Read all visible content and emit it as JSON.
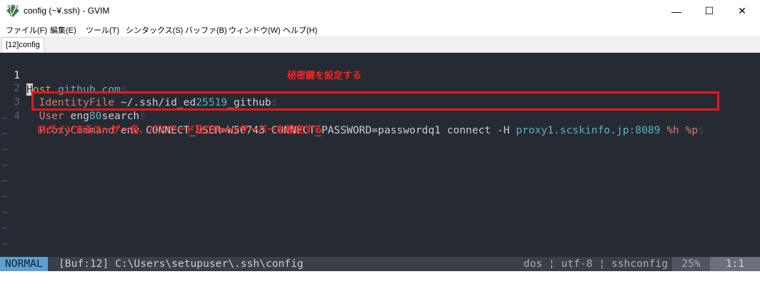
{
  "window": {
    "title": "config (~¥.ssh) - GVIM",
    "controls": {
      "minimize": "—",
      "maximize": "☐",
      "close": "✕"
    }
  },
  "menu": [
    "ファイル(F)",
    "編集(E)",
    "ツール(T)",
    "シンタックス(S)",
    "バッファ(B)",
    "ウィンドウ(W)",
    "ヘルプ(H)"
  ],
  "tab": {
    "label": "[12]config"
  },
  "editor": {
    "line_numbers": [
      "1",
      "2",
      "3",
      "4"
    ],
    "empty_line_marker": "~",
    "eol_marker": "$",
    "line1": {
      "cursor_char": "H",
      "keyword_rest": "ost",
      "host": "github.com"
    },
    "line2": {
      "key": "IdentityFile",
      "value_a": "~/.ssh/id_ed",
      "value_num": "25519",
      "value_b": "_github"
    },
    "line3": {
      "key": "User",
      "value_a": "eng",
      "value_num": "80",
      "value_b": "search"
    },
    "line4": {
      "key": "ProxyCommand",
      "command": "env CONNECT_USER=W50743 CONNECT_PASSWORD=passwordq1 connect -H ",
      "proxy": "proxy1.scskinfo.jp:8089",
      "args": "%h %p"
    }
  },
  "annotations": {
    "identity_note": "秘密鍵を設定する",
    "proxy_note": "ログインするユーザー名、パスワード及びPorxyサーバーを設定する"
  },
  "statusline": {
    "mode": "NORMAL",
    "buffer": "[Buf:12] C:\\Users\\setupuser\\.ssh\\config",
    "fileinfo": "dos ¦ utf-8 ¦ sshconfig",
    "percent": "25%",
    "position": "1:1"
  },
  "colors": {
    "editor_bg": "#262b33",
    "mode_bg": "#5c9fd0",
    "annotation_red": "#ff2020"
  }
}
